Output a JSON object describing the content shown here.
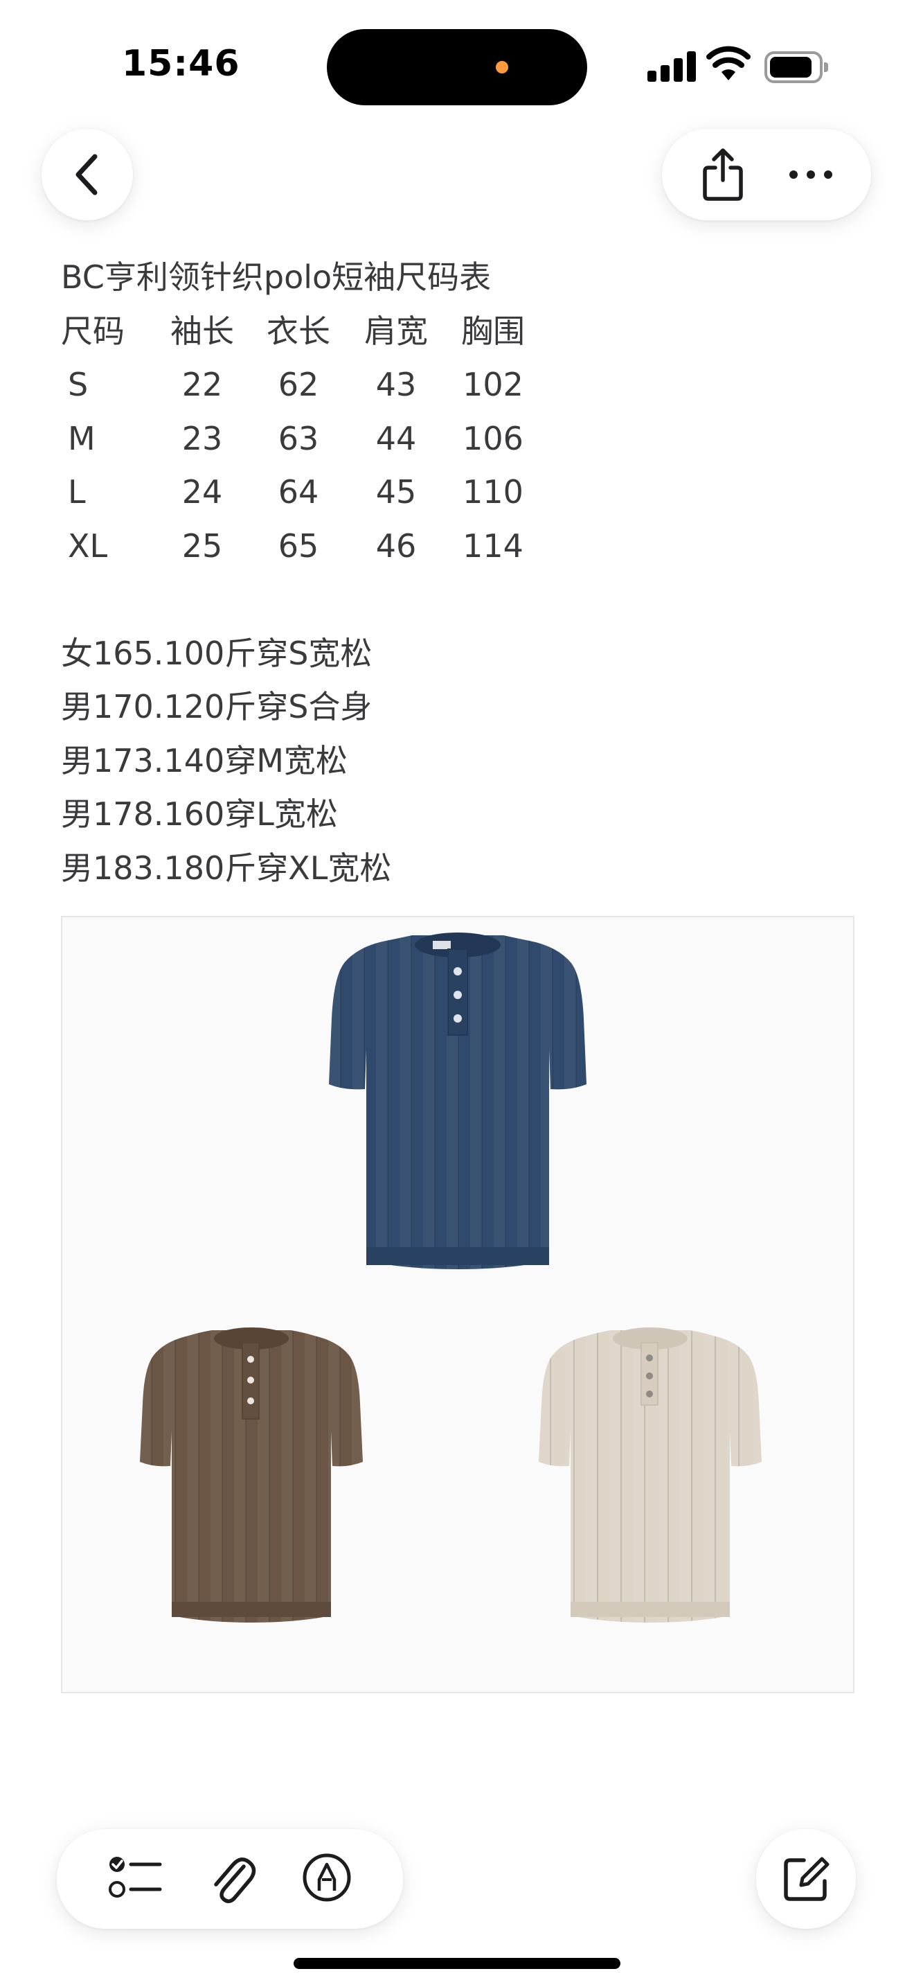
{
  "status_bar": {
    "time": "15:46",
    "icons": [
      "cellular-signal-icon",
      "wifi-icon",
      "battery-icon"
    ],
    "island_indicator_color": "#ff9a3c"
  },
  "nav": {
    "back": "chevron-left-icon",
    "share": "share-icon",
    "more": "more-horizontal-icon"
  },
  "note": {
    "title": "BC亨利领针织polo短袖尺码表",
    "table": {
      "headers": [
        "尺码",
        "袖长",
        "衣长",
        "肩宽",
        "胸围"
      ],
      "rows": [
        [
          "S",
          "22",
          "62",
          "43",
          "102"
        ],
        [
          "M",
          "23",
          "63",
          "44",
          "106"
        ],
        [
          "L",
          "24",
          "64",
          "45",
          "110"
        ],
        [
          "XL",
          "25",
          "65",
          "46",
          "114"
        ]
      ]
    },
    "recommendations": [
      "女165.100斤穿S宽松",
      "男170.120斤穿S合身",
      "男173.140穿M宽松",
      "男178.160穿L宽松",
      "男183.180斤穿XL宽松"
    ]
  },
  "image": {
    "items": [
      "navy-polo",
      "brown-polo",
      "beige-polo"
    ],
    "colors": {
      "navy": "#2f4a6c",
      "brown": "#6b5645",
      "beige": "#ddd5c8"
    }
  },
  "toolbar": {
    "checklist": "checklist-icon",
    "attach": "paperclip-icon",
    "markup": "markup-pen-icon",
    "compose": "compose-icon"
  }
}
